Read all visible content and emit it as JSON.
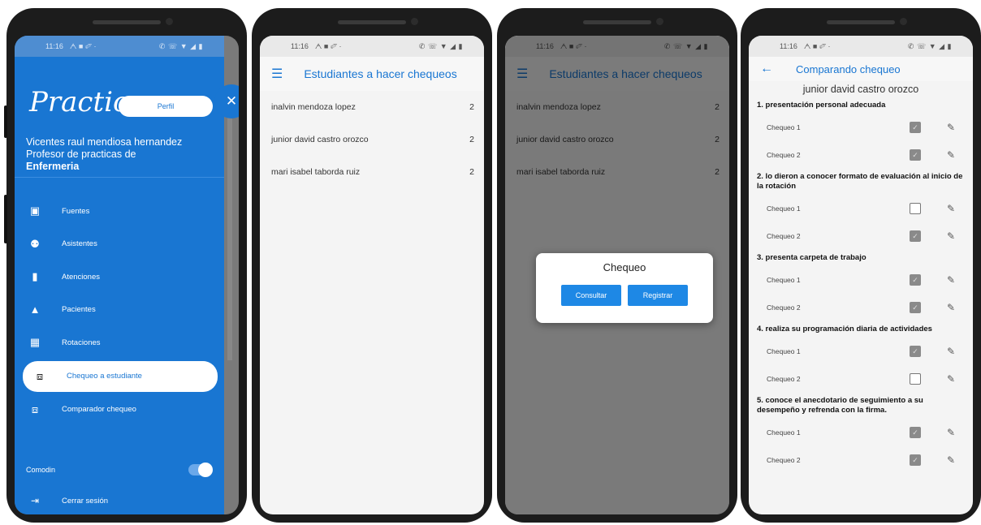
{
  "status": {
    "time": "11:16",
    "icons_left": "ᗅ ■ ✐ ·",
    "icons_right": "✆ ☏ ▼ ◢ ▮"
  },
  "drawer": {
    "brand": "Practica",
    "profile_button": "Perfil",
    "user_name": "Vicentes raul mendiosa hernandez",
    "user_role": "Profesor de practicas de",
    "user_area": "Enfermeria",
    "menu_items": [
      {
        "label": "Fuentes",
        "icon": "calendar-icon",
        "glyph": "🗓"
      },
      {
        "label": "Asistentes",
        "icon": "people-icon",
        "glyph": "👥"
      },
      {
        "label": "Atenciones",
        "icon": "document-icon",
        "glyph": "▮"
      },
      {
        "label": "Pacientes",
        "icon": "person-icon",
        "glyph": "▲"
      },
      {
        "label": "Rotaciones",
        "icon": "rotation-icon",
        "glyph": "▦"
      },
      {
        "label": "Chequeo a estudiante",
        "icon": "checklist-icon",
        "glyph": "⧈"
      },
      {
        "label": "Comparador chequeo",
        "icon": "compare-icon",
        "glyph": "⧈"
      }
    ],
    "mode_label": "Comodin",
    "logout_label": "Cerrar sesión"
  },
  "list_screen": {
    "title": "Estudiantes a hacer chequeos",
    "students": [
      {
        "name": "inalvin mendoza lopez",
        "count": "2"
      },
      {
        "name": "junior david castro orozco",
        "count": "2"
      },
      {
        "name": "mari isabel taborda ruiz",
        "count": "2"
      }
    ]
  },
  "dialog": {
    "title": "Chequeo",
    "consult_button": "Consultar",
    "register_button": "Registrar"
  },
  "compare_screen": {
    "title": "Comparando chequeo",
    "student_name": "junior david castro orozco",
    "criteria": [
      {
        "title": "1. presentación personal adecuada",
        "checks": [
          {
            "label": "Chequeo 1",
            "checked": true
          },
          {
            "label": "Chequeo 2",
            "checked": true
          }
        ]
      },
      {
        "title": "2. lo dieron a conocer formato de evaluación al inicio de la rotación",
        "checks": [
          {
            "label": "Chequeo 1",
            "checked": false
          },
          {
            "label": "Chequeo 2",
            "checked": true
          }
        ]
      },
      {
        "title": "3. presenta carpeta de trabajo",
        "checks": [
          {
            "label": "Chequeo 1",
            "checked": true
          },
          {
            "label": "Chequeo 2",
            "checked": true
          }
        ]
      },
      {
        "title": "4. realiza su programación diaria de actividades",
        "checks": [
          {
            "label": "Chequeo 1",
            "checked": true
          },
          {
            "label": "Chequeo 2",
            "checked": false
          }
        ]
      },
      {
        "title": "5. conoce el anecdotario de seguimiento a su desempeño y refrenda con la firma.",
        "checks": [
          {
            "label": "Chequeo 1",
            "checked": true
          },
          {
            "label": "Chequeo 2",
            "checked": true
          }
        ]
      }
    ]
  },
  "colors": {
    "primary": "#1976d2",
    "button": "#1e88e5",
    "phone": "#1c1c1c"
  }
}
